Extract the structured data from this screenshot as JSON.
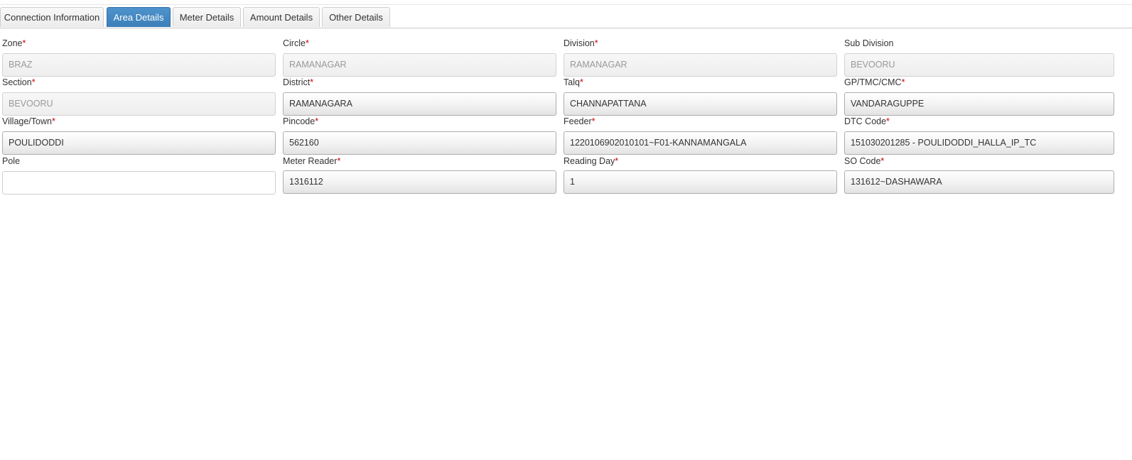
{
  "tabs": [
    {
      "label": "Connection Information",
      "active": false
    },
    {
      "label": "Area Details",
      "active": true
    },
    {
      "label": "Meter Details",
      "active": false
    },
    {
      "label": "Amount Details",
      "active": false
    },
    {
      "label": "Other Details",
      "active": false
    }
  ],
  "required_marker": "*",
  "form": {
    "zone": {
      "label": "Zone",
      "required": true,
      "value": "BRAZ",
      "state": "disabled"
    },
    "circle": {
      "label": "Circle",
      "required": true,
      "value": "RAMANAGAR",
      "state": "disabled"
    },
    "division": {
      "label": "Division",
      "required": true,
      "value": "RAMANAGAR",
      "state": "disabled"
    },
    "sub_division": {
      "label": "Sub Division",
      "required": false,
      "value": "BEVOORU",
      "state": "disabled"
    },
    "section": {
      "label": "Section",
      "required": true,
      "value": "BEVOORU",
      "state": "disabled"
    },
    "district": {
      "label": "District",
      "required": true,
      "value": "RAMANAGARA",
      "state": "select"
    },
    "talq": {
      "label": "Talq",
      "required": true,
      "value": "CHANNAPATTANA",
      "state": "select"
    },
    "gp_tmc_cmc": {
      "label": "GP/TMC/CMC",
      "required": true,
      "value": "VANDARAGUPPE",
      "state": "select"
    },
    "village_town": {
      "label": "Village/Town",
      "required": true,
      "value": "POULIDODDI",
      "state": "select"
    },
    "pincode": {
      "label": "Pincode",
      "required": true,
      "value": "562160",
      "state": "select"
    },
    "feeder": {
      "label": "Feeder",
      "required": true,
      "value": "1220106902010101~F01-KANNAMANGALA",
      "state": "select"
    },
    "dtc_code": {
      "label": "DTC Code",
      "required": true,
      "value": "151030201285 - POULIDODDI_HALLA_IP_TC",
      "state": "select"
    },
    "pole": {
      "label": "Pole",
      "required": false,
      "value": "",
      "state": "empty"
    },
    "meter_reader": {
      "label": "Meter Reader",
      "required": true,
      "value": "1316112",
      "state": "select"
    },
    "reading_day": {
      "label": "Reading Day",
      "required": true,
      "value": "1",
      "state": "select"
    },
    "so_code": {
      "label": "SO Code",
      "required": true,
      "value": "131612~DASHAWARA",
      "state": "select"
    }
  },
  "colors": {
    "active_tab": "#3c7fb8",
    "required_marker": "#cc0000",
    "disabled_text": "#999999"
  }
}
